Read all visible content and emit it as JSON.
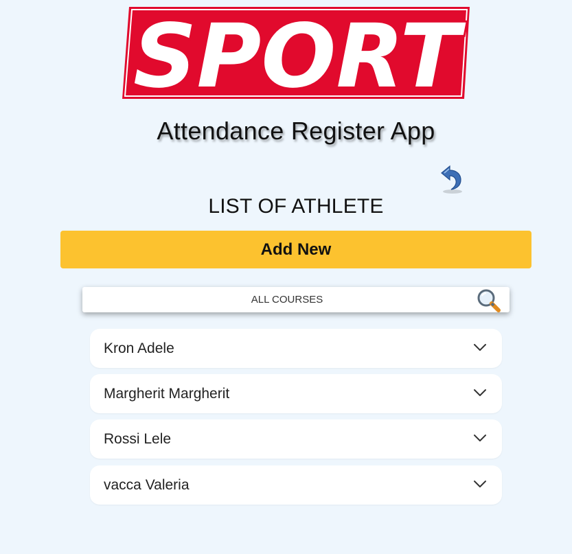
{
  "header": {
    "logo_text": "SPORT",
    "app_title": "Attendance Register App"
  },
  "main": {
    "list_title": "LIST OF ATHLETE",
    "add_button_label": "Add New",
    "filter": {
      "selected": "ALL COURSES"
    },
    "athletes": [
      {
        "name": "Kron Adele"
      },
      {
        "name": "Margherit Margherit"
      },
      {
        "name": "Rossi Lele"
      },
      {
        "name": "vacca Valeria"
      }
    ]
  },
  "icons": {
    "back": "back-arrow-icon",
    "search": "magnifier-icon",
    "expand": "chevron-down-icon"
  },
  "colors": {
    "background": "#eef6fd",
    "brand_red": "#e10a2d",
    "accent_yellow": "#fcc22f",
    "back_arrow_blue": "#3d6fb6"
  }
}
